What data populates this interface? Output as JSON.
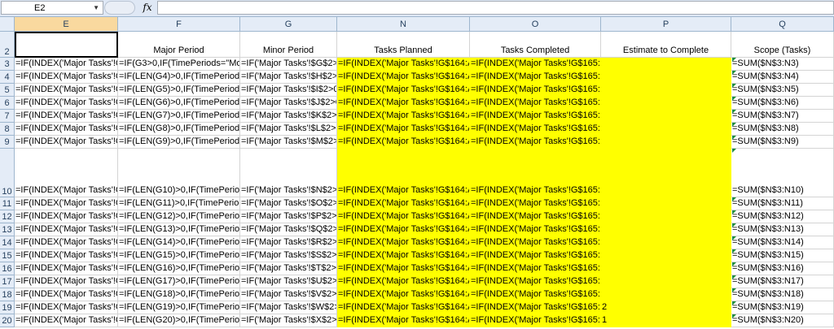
{
  "formula_bar": {
    "name_box": "E2",
    "fx_label": "fx",
    "formula_value": ""
  },
  "columns": [
    {
      "id": "E",
      "label": "E",
      "selected": true
    },
    {
      "id": "F",
      "label": "F",
      "selected": false
    },
    {
      "id": "G",
      "label": "G",
      "selected": false
    },
    {
      "id": "N",
      "label": "N",
      "selected": false
    },
    {
      "id": "O",
      "label": "O",
      "selected": false
    },
    {
      "id": "P",
      "label": "P",
      "selected": false
    },
    {
      "id": "Q",
      "label": "Q",
      "selected": false
    }
  ],
  "header_row": {
    "row": "2",
    "E": "",
    "F": "Major Period",
    "G": "Minor Period",
    "N": "Tasks Planned",
    "O": "Tasks Completed",
    "P": "Estimate to Complete",
    "Q": "Scope (Tasks)"
  },
  "rows": [
    {
      "row": "3",
      "E": "=IF(INDEX('Major Tasks'!G",
      "F": "=IF(G3>0,IF(TimePeriods=\"Mor",
      "G": "=IF('Major Tasks'!$G$2>0",
      "N": "=IF(INDEX('Major Tasks'!G$164:AI",
      "O": "=IF(INDEX('Major Tasks'!G$165:AI",
      "P": "",
      "Q": "=SUM($N$3:N3)"
    },
    {
      "row": "4",
      "E": "=IF(INDEX('Major Tasks'!G",
      "F": "=IF(LEN(G4)>0,IF(TimePeriods",
      "G": "=IF('Major Tasks'!$H$2>0",
      "N": "=IF(INDEX('Major Tasks'!G$164:AI",
      "O": "=IF(INDEX('Major Tasks'!G$165:AI",
      "P": "",
      "Q": "=SUM($N$3:N4)"
    },
    {
      "row": "5",
      "E": "=IF(INDEX('Major Tasks'!G",
      "F": "=IF(LEN(G5)>0,IF(TimePeriods",
      "G": "=IF('Major Tasks'!$I$2>0,",
      "N": "=IF(INDEX('Major Tasks'!G$164:AI",
      "O": "=IF(INDEX('Major Tasks'!G$165:AI",
      "P": "",
      "Q": "=SUM($N$3:N5)"
    },
    {
      "row": "6",
      "E": "=IF(INDEX('Major Tasks'!G",
      "F": "=IF(LEN(G6)>0,IF(TimePeriods",
      "G": "=IF('Major Tasks'!$J$2>0,",
      "N": "=IF(INDEX('Major Tasks'!G$164:AI",
      "O": "=IF(INDEX('Major Tasks'!G$165:AI",
      "P": "",
      "Q": "=SUM($N$3:N6)"
    },
    {
      "row": "7",
      "E": "=IF(INDEX('Major Tasks'!G",
      "F": "=IF(LEN(G7)>0,IF(TimePeriods",
      "G": "=IF('Major Tasks'!$K$2>0,",
      "N": "=IF(INDEX('Major Tasks'!G$164:AI",
      "O": "=IF(INDEX('Major Tasks'!G$165:AI",
      "P": "",
      "Q": "=SUM($N$3:N7)"
    },
    {
      "row": "8",
      "E": "=IF(INDEX('Major Tasks'!G",
      "F": "=IF(LEN(G8)>0,IF(TimePeriods",
      "G": "=IF('Major Tasks'!$L$2>0,",
      "N": "=IF(INDEX('Major Tasks'!G$164:AI",
      "O": "=IF(INDEX('Major Tasks'!G$165:AI",
      "P": "",
      "Q": "=SUM($N$3:N8)"
    },
    {
      "row": "9",
      "E": "=IF(INDEX('Major Tasks'!G",
      "F": "=IF(LEN(G9)>0,IF(TimePeriods",
      "G": "=IF('Major Tasks'!$M$2>0",
      "N": "=IF(INDEX('Major Tasks'!G$164:AI",
      "O": "=IF(INDEX('Major Tasks'!G$165:AI",
      "P": "",
      "Q": "=SUM($N$3:N9)"
    },
    {
      "row": "10",
      "E": "=IF(INDEX('Major Tasks'!G",
      "F": "=IF(LEN(G10)>0,IF(TimePeriod",
      "G": "=IF('Major Tasks'!$N$2>0",
      "N": "=IF(INDEX('Major Tasks'!G$164:AI",
      "O": "=IF(INDEX('Major Tasks'!G$165:AI",
      "P": "",
      "Q": "=SUM($N$3:N10)"
    },
    {
      "row": "11",
      "E": "=IF(INDEX('Major Tasks'!G",
      "F": "=IF(LEN(G11)>0,IF(TimePeriod",
      "G": "=IF('Major Tasks'!$O$2>0",
      "N": "=IF(INDEX('Major Tasks'!G$164:AI",
      "O": "=IF(INDEX('Major Tasks'!G$165:AI",
      "P": "",
      "Q": "=SUM($N$3:N11)"
    },
    {
      "row": "12",
      "E": "=IF(INDEX('Major Tasks'!G",
      "F": "=IF(LEN(G12)>0,IF(TimePeriod",
      "G": "=IF('Major Tasks'!$P$2>0",
      "N": "=IF(INDEX('Major Tasks'!G$164:AI",
      "O": "=IF(INDEX('Major Tasks'!G$165:AI",
      "P": "",
      "Q": "=SUM($N$3:N12)"
    },
    {
      "row": "13",
      "E": "=IF(INDEX('Major Tasks'!G",
      "F": "=IF(LEN(G13)>0,IF(TimePeriod",
      "G": "=IF('Major Tasks'!$Q$2>0",
      "N": "=IF(INDEX('Major Tasks'!G$164:AI",
      "O": "=IF(INDEX('Major Tasks'!G$165:AI",
      "P": "",
      "Q": "=SUM($N$3:N13)"
    },
    {
      "row": "14",
      "E": "=IF(INDEX('Major Tasks'!G",
      "F": "=IF(LEN(G14)>0,IF(TimePeriod",
      "G": "=IF('Major Tasks'!$R$2>0",
      "N": "=IF(INDEX('Major Tasks'!G$164:AI",
      "O": "=IF(INDEX('Major Tasks'!G$165:AI",
      "P": "",
      "Q": "=SUM($N$3:N14)"
    },
    {
      "row": "15",
      "E": "=IF(INDEX('Major Tasks'!G",
      "F": "=IF(LEN(G15)>0,IF(TimePeriod",
      "G": "=IF('Major Tasks'!$S$2>0",
      "N": "=IF(INDEX('Major Tasks'!G$164:AI",
      "O": "=IF(INDEX('Major Tasks'!G$165:AI",
      "P": "",
      "Q": "=SUM($N$3:N15)"
    },
    {
      "row": "16",
      "E": "=IF(INDEX('Major Tasks'!G",
      "F": "=IF(LEN(G16)>0,IF(TimePeriod",
      "G": "=IF('Major Tasks'!$T$2>0",
      "N": "=IF(INDEX('Major Tasks'!G$164:AI",
      "O": "=IF(INDEX('Major Tasks'!G$165:AI",
      "P": "",
      "Q": "=SUM($N$3:N16)"
    },
    {
      "row": "17",
      "E": "=IF(INDEX('Major Tasks'!G",
      "F": "=IF(LEN(G17)>0,IF(TimePeriod",
      "G": "=IF('Major Tasks'!$U$2>0",
      "N": "=IF(INDEX('Major Tasks'!G$164:AI",
      "O": "=IF(INDEX('Major Tasks'!G$165:AI",
      "P": "",
      "Q": "=SUM($N$3:N17)"
    },
    {
      "row": "18",
      "E": "=IF(INDEX('Major Tasks'!G",
      "F": "=IF(LEN(G18)>0,IF(TimePeriod",
      "G": "=IF('Major Tasks'!$V$2>0",
      "N": "=IF(INDEX('Major Tasks'!G$164:AI",
      "O": "=IF(INDEX('Major Tasks'!G$165:AI",
      "P": "",
      "Q": "=SUM($N$3:N18)"
    },
    {
      "row": "19",
      "E": "=IF(INDEX('Major Tasks'!G",
      "F": "=IF(LEN(G19)>0,IF(TimePeriod",
      "G": "=IF('Major Tasks'!$W$2>0",
      "N": "=IF(INDEX('Major Tasks'!G$164:AI",
      "O": "=IF(INDEX('Major Tasks'!G$165:AI",
      "P": "2",
      "Q": "=SUM($N$3:N19)"
    },
    {
      "row": "20",
      "E": "=IF(INDEX('Major Tasks'!G",
      "F": "=IF(LEN(G20)>0,IF(TimePeriod",
      "G": "=IF('Major Tasks'!$X$2>0",
      "N": "=IF(INDEX('Major Tasks'!G$164:AI",
      "O": "=IF(INDEX('Major Tasks'!G$165:AI",
      "P": "1",
      "Q": "=SUM($N$3:N20)"
    }
  ],
  "colors": {
    "highlight": "#ffff00",
    "header_bg": "#e4ecf7",
    "selected_header": "#f9d99f",
    "error_triangle": "#1f8c3f"
  },
  "icons": [
    "dropdown-arrow-icon",
    "fx-icon"
  ]
}
